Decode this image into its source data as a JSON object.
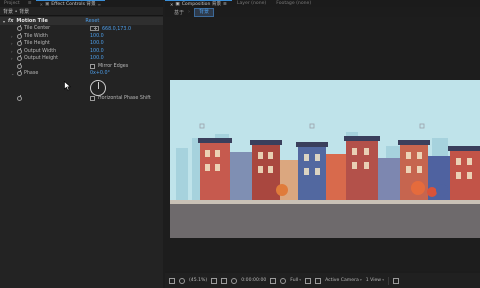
{
  "left_panel": {
    "tabs": [
      {
        "label": "Project",
        "active": false
      },
      {
        "label": "Effect Controls 背景",
        "active": true
      }
    ],
    "breadcrumb": "背景 • 背景",
    "effect": {
      "badge": "fx",
      "name": "Motion Tile",
      "reset_label": "Reset"
    },
    "properties": [
      {
        "name": "Tile Center",
        "value": "668.0,173.0"
      },
      {
        "name": "Tile Width",
        "value": "100.0"
      },
      {
        "name": "Tile Height",
        "value": "100.0"
      },
      {
        "name": "Output Width",
        "value": "100.0"
      },
      {
        "name": "Output Height",
        "value": "100.0"
      }
    ],
    "mirror_edges_label": "Mirror Edges",
    "phase": {
      "name": "Phase",
      "value": "0x+0.0°"
    },
    "horizontal_phase_shift_label": "Horizontal Phase Shift"
  },
  "right_panel": {
    "tabs": [
      {
        "label": "Composition 背景",
        "active": true
      },
      {
        "label": "Layer (none)",
        "active": false
      },
      {
        "label": "Footage (none)",
        "active": false
      }
    ],
    "comp_bar": {
      "parent": "基于",
      "current": "背景"
    },
    "bottom_bar": {
      "zoom": "(45.1%)",
      "timecode": "0:00:00:00",
      "resolution": "Full",
      "camera": "Active Camera",
      "view": "1 View"
    }
  },
  "colors": {
    "accent_blue": "#4d9eea",
    "sky": "#bfe3ea",
    "ground": "#6e6a6c"
  }
}
